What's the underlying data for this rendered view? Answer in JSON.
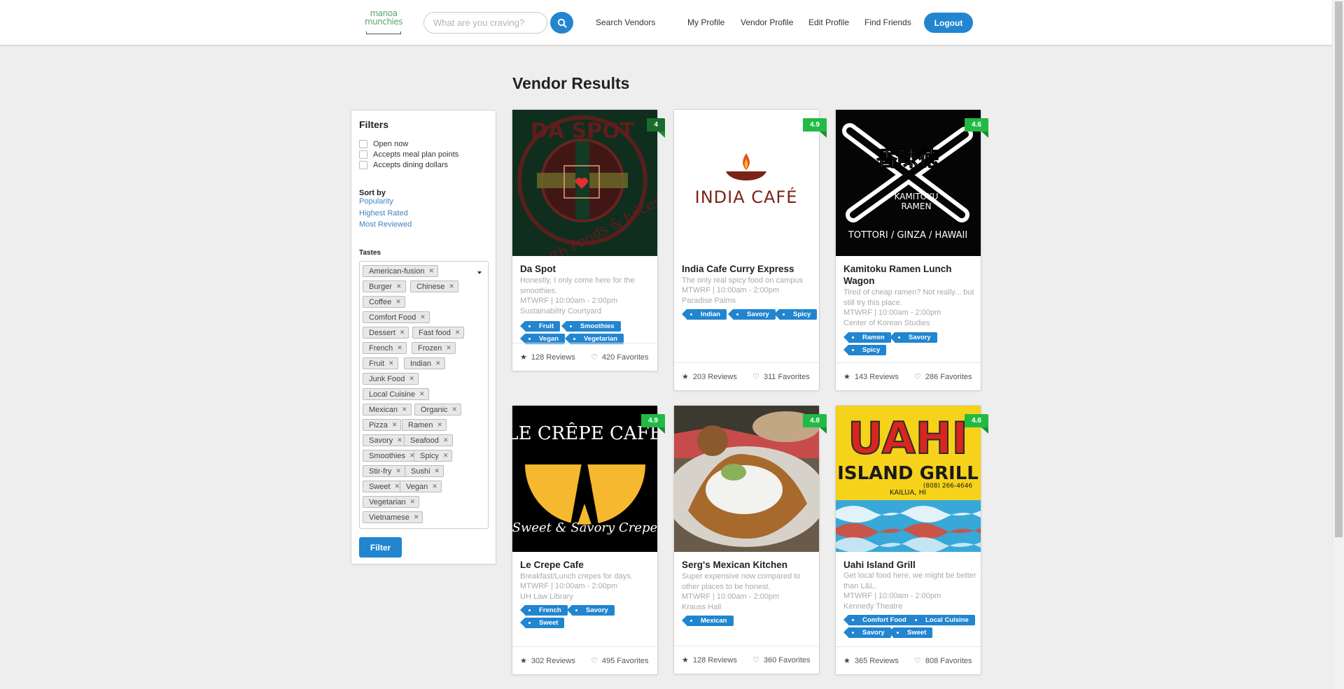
{
  "nav": {
    "logo_line1": "manoa",
    "logo_line2": "munchies",
    "search_placeholder": "What are you craving?",
    "links": [
      "Search Vendors",
      "My Profile",
      "Vendor Profile",
      "Edit Profile",
      "Find Friends"
    ],
    "logout": "Logout",
    "accent": "#2185d0"
  },
  "page_title": "Vendor Results",
  "filters": {
    "title": "Filters",
    "checkboxes": [
      "Open now",
      "Accepts meal plan points",
      "Accepts dining dollars"
    ],
    "sort_label": "Sort by",
    "sort_options": [
      "Popularity",
      "Highest Rated",
      "Most Reviewed"
    ],
    "tastes_label": "Tastes",
    "tastes": [
      "American-fusion",
      "Burger",
      "Chinese",
      "Coffee",
      "Comfort Food",
      "Dessert",
      "Fast food",
      "French",
      "Frozen",
      "Fruit",
      "Indian",
      "Junk Food",
      "Local Cuisine",
      "Mexican",
      "Organic",
      "Pizza",
      "Ramen",
      "Savory",
      "Seafood",
      "Smoothies",
      "Spicy",
      "Stir-fry",
      "Sushi",
      "Sweet",
      "Vegan",
      "Vegetarian",
      "Vietnamese"
    ],
    "filter_button": "Filter"
  },
  "vendors": [
    {
      "name": "Da Spot",
      "rating": "4",
      "description": "Honestly, I only come here for the smoothies.",
      "hours": "MTWRF | 10:00am - 2:00pm",
      "location": "Sustainability Courtyard",
      "tags": [
        "Fruit",
        "Smoothies",
        "Vegan",
        "Vegetarian"
      ],
      "reviews": "128 Reviews",
      "favorites": "420 Favorites",
      "image_text": [
        "DA SPOT",
        "Health Foods & Juices"
      ],
      "rating_color": "#1b6b2c"
    },
    {
      "name": "India Cafe Curry Express",
      "rating": "4.9",
      "description": "The only real spicy food on campus",
      "hours": "MTWRF | 10:00am - 2:00pm",
      "location": "Paradise Palms",
      "tags": [
        "Indian",
        "Savory",
        "Spicy"
      ],
      "reviews": "203 Reviews",
      "favorites": "311 Favorites",
      "image_text": [
        "INDIA CAFÉ"
      ],
      "rating_color": "#21ba45"
    },
    {
      "name": "Kamitoku Ramen Lunch Wagon",
      "rating": "4.6",
      "description": "Tired of cheap ramen? Not really... but still try this place.",
      "hours": "MTWRF | 10:00am - 2:00pm",
      "location": "Center of Korean Studies",
      "tags": [
        "Ramen",
        "Savory",
        "Spicy"
      ],
      "reviews": "143 Reviews",
      "favorites": "286 Favorites",
      "image_text": [
        "香味徳",
        "KAMITOKU",
        "RAMEN",
        "TOTTORI / GINZA / HAWAII"
      ],
      "rating_color": "#21ba45"
    },
    {
      "name": "Le Crepe Cafe",
      "rating": "4.9",
      "description": "Breakfast/Lunch crepes for days.",
      "hours": "MTWRF | 10:00am - 2:00pm",
      "location": "UH Law Library",
      "tags": [
        "French",
        "Savory",
        "Sweet"
      ],
      "reviews": "302 Reviews",
      "favorites": "495 Favorites",
      "image_text": [
        "LE CRÊPE CAFE",
        "Sweet & Savory Crepes"
      ],
      "rating_color": "#21ba45"
    },
    {
      "name": "Serg's Mexican Kitchen",
      "rating": "4.8",
      "description": "Super expensive now compared to other places to be honest.",
      "hours": "MTWRF | 10:00am - 2:00pm",
      "location": "Krauss Hall",
      "tags": [
        "Mexican"
      ],
      "reviews": "128 Reviews",
      "favorites": "360 Favorites",
      "image_text": [],
      "rating_color": "#21ba45"
    },
    {
      "name": "Uahi Island Grill",
      "rating": "4.6",
      "description": "Get local food here, we might be better than L&L.",
      "hours": "MTWRF | 10:00am - 2:00pm",
      "location": "Kennedy Theatre",
      "tags": [
        "Comfort Food",
        "Local Cuisine",
        "Savory",
        "Sweet"
      ],
      "reviews": "365 Reviews",
      "favorites": "808 Favorites",
      "image_text": [
        "UAHI",
        "ISLAND GRILL",
        "KAILUA, HI",
        "(808) 266-4646"
      ],
      "rating_color": "#21ba45"
    }
  ]
}
